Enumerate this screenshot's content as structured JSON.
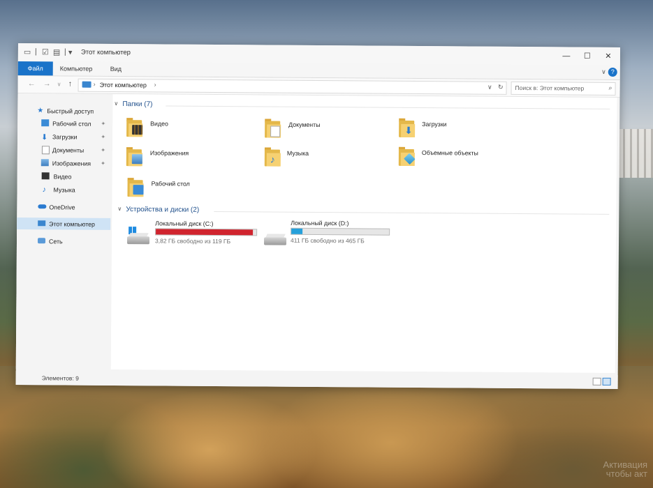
{
  "window": {
    "title": "Этот компьютер",
    "controls": {
      "minimize": "—",
      "maximize": "☐",
      "close": "✕"
    }
  },
  "ribbon": {
    "tabs": [
      {
        "label": "Файл",
        "active": true
      },
      {
        "label": "Компьютер",
        "active": false
      },
      {
        "label": "Вид",
        "active": false
      }
    ],
    "collapse_icon": "∨",
    "help_icon": "?"
  },
  "address": {
    "back": "←",
    "forward": "→",
    "recent": "∨",
    "up": "↑",
    "path": "Этот компьютер",
    "sep": "›",
    "dropdown": "∨",
    "refresh": "↻",
    "search_placeholder": "Поиск в: Этот компьютер",
    "search_icon": "⌕"
  },
  "sidebar": {
    "items": [
      {
        "label": "Быстрый доступ",
        "icon": "star-icon",
        "pinned": false
      },
      {
        "label": "Рабочий стол",
        "icon": "desktop-icon",
        "pinned": true
      },
      {
        "label": "Загрузки",
        "icon": "download-icon",
        "pinned": true
      },
      {
        "label": "Документы",
        "icon": "documents-icon",
        "pinned": true
      },
      {
        "label": "Изображения",
        "icon": "pictures-icon",
        "pinned": true
      },
      {
        "label": "Видео",
        "icon": "video-icon",
        "pinned": false
      },
      {
        "label": "Музыка",
        "icon": "music-icon",
        "pinned": false
      },
      {
        "label": "OneDrive",
        "icon": "cloud-icon",
        "pinned": false
      },
      {
        "label": "Этот компьютер",
        "icon": "computer-icon",
        "pinned": false,
        "selected": true
      },
      {
        "label": "Сеть",
        "icon": "network-icon",
        "pinned": false
      }
    ],
    "pin_glyph": "✦"
  },
  "folders_group": {
    "header": "Папки (7)",
    "arrow": "∨",
    "items": [
      {
        "label": "Видео",
        "badge": "video"
      },
      {
        "label": "Документы",
        "badge": "documents"
      },
      {
        "label": "Загрузки",
        "badge": "downloads"
      },
      {
        "label": "Изображения",
        "badge": "pictures"
      },
      {
        "label": "Музыка",
        "badge": "music"
      },
      {
        "label": "Объемные объекты",
        "badge": "3d"
      },
      {
        "label": "Рабочий стол",
        "badge": "desktop"
      }
    ]
  },
  "drives_group": {
    "header": "Устройства и диски (2)",
    "arrow": "∨",
    "items": [
      {
        "label": "Локальный диск (C:)",
        "free": "3,82 ГБ свободно из 119 ГБ",
        "used_fraction": 0.968,
        "bar_color": "#d0242e",
        "system": true
      },
      {
        "label": "Локальный диск (D:)",
        "free": "411 ГБ свободно из 465 ГБ",
        "used_fraction": 0.116,
        "bar_color": "#26a0da",
        "system": false
      }
    ]
  },
  "status": {
    "count": "Элементов: 9"
  },
  "colors": {
    "accent": "#1a73c9",
    "selection": "#cfe3f5",
    "group_header": "#1f4f8b"
  }
}
